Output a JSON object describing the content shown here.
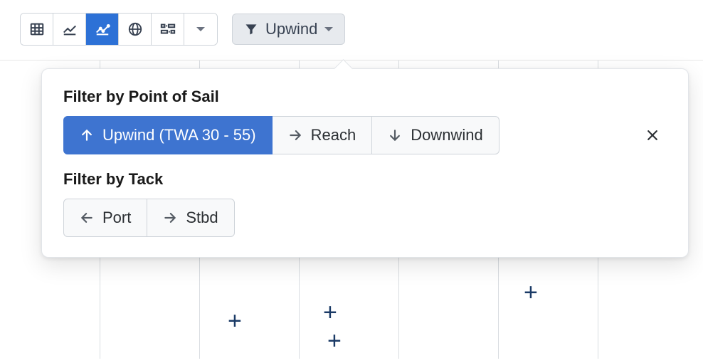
{
  "toolbar": {
    "filter_label": "Upwind"
  },
  "popover": {
    "section_pos_title": "Filter by Point of Sail",
    "section_tack_title": "Filter by Tack",
    "pos": {
      "upwind_label": "Upwind (TWA 30 - 55)",
      "reach_label": "Reach",
      "downwind_label": "Downwind"
    },
    "tack": {
      "port_label": "Port",
      "stbd_label": "Stbd"
    }
  },
  "icons": {
    "table": "table-icon",
    "line_chart": "line-chart-icon",
    "scatter_chart": "scatter-chart-icon",
    "globe": "globe-icon",
    "tune": "tune-icon",
    "caret": "caret-down-icon",
    "funnel": "funnel-icon",
    "arrow_up": "arrow-up-icon",
    "arrow_right": "arrow-right-icon",
    "arrow_down": "arrow-down-icon",
    "arrow_left": "arrow-left-icon",
    "close": "close-icon"
  },
  "chart_data": {
    "type": "scatter",
    "title": "",
    "xlabel": "",
    "ylabel": "",
    "columns_visible": 6,
    "points_visible": [
      {
        "col": 1,
        "row": 0
      },
      {
        "col": 2,
        "row": 0
      },
      {
        "col": 2,
        "row": 1
      },
      {
        "col": 4,
        "row": -1
      }
    ],
    "note": "Only a partial scatter chart is visible behind the popover; axis values are not legible in the screenshot."
  }
}
